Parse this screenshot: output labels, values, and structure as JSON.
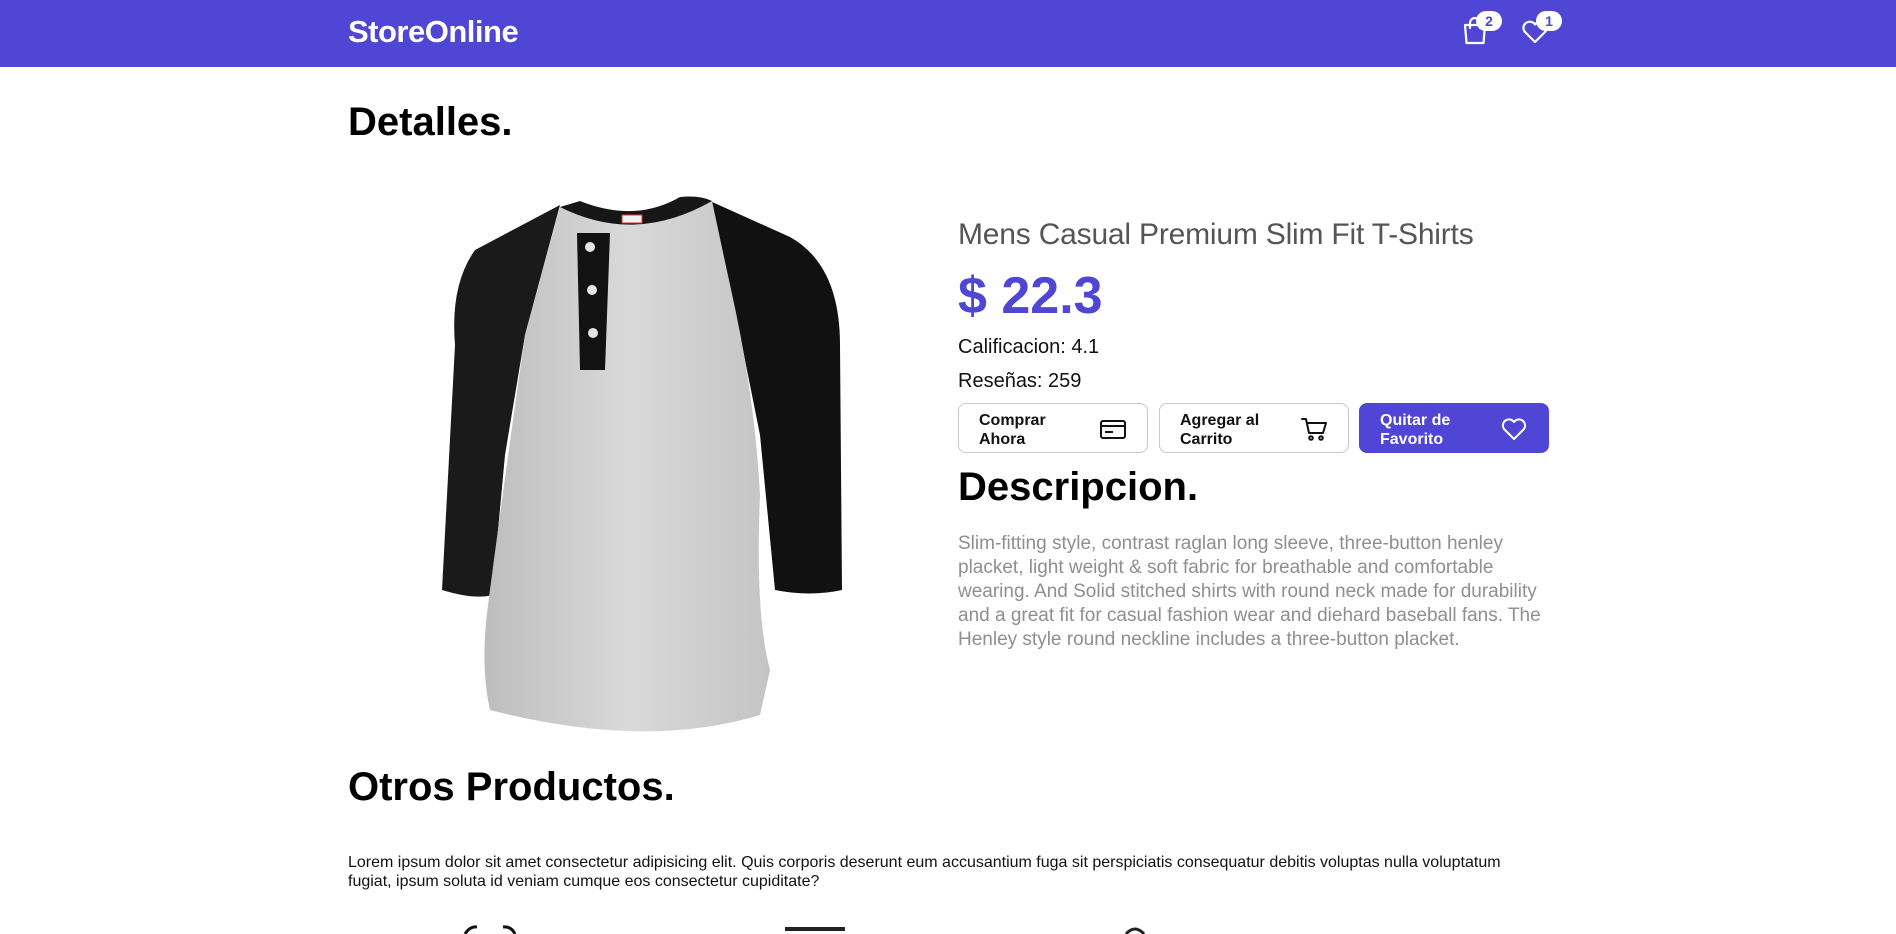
{
  "navbar": {
    "brand": "StoreOnline",
    "cart_count": "2",
    "favorites_count": "1",
    "background": "#4f46d6"
  },
  "page_title": "Detalles.",
  "product": {
    "name": "Mens Casual Premium Slim Fit T-Shirts",
    "price": "$ 22.3",
    "rating_label": "Calificacion: 4.1",
    "reviews_label": "Reseñas: 259",
    "buttons": {
      "buy_now": "Comprar Ahora",
      "add_to_cart": "Agregar al Carrito",
      "remove_favorite": "Quitar de Favorito"
    },
    "description_title": "Descripcion.",
    "description": "Slim-fitting style, contrast raglan long sleeve, three-button henley placket, light weight & soft fabric for breathable and comfortable wearing. And Solid stitched shirts with round neck made for durability and a great fit for casual fashion wear and diehard baseball fans. The Henley style round neckline includes a three-button placket."
  },
  "other_products": {
    "title": "Otros Productos.",
    "text": "Lorem ipsum dolor sit amet consectetur adipisicing elit. Quis corporis deserunt eum accusantium fuga sit perspiciatis consequatur debitis voluptas nulla voluptatum fugiat, ipsum soluta id veniam cumque eos consectetur cupiditate?"
  },
  "icons": {
    "cart": "shopping-bag-icon",
    "favorites": "heart-icon",
    "buy": "credit-card-icon",
    "add_cart": "shopping-cart-icon",
    "favorite": "heart-outline-icon"
  },
  "colors": {
    "accent": "#4f46d6",
    "description_text": "#8f8f8f"
  }
}
